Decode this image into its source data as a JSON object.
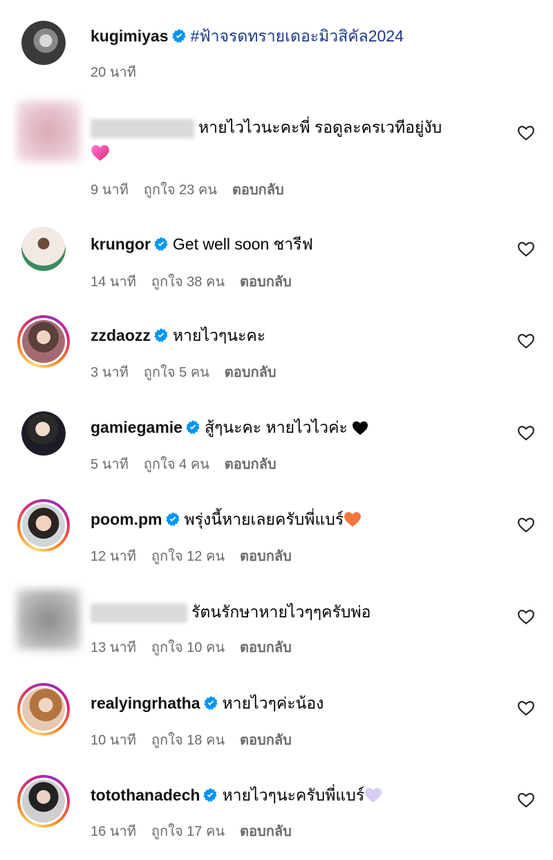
{
  "caption": {
    "username": "kugimiyas",
    "hashtag": "#ฟ้าจรดทรายเดอะมิวสิคัล2024",
    "time": "20 นาที"
  },
  "comments": [
    {
      "username": "",
      "text": "หายไวไวนะคะพี่ รอดูละครเวทีอยู่งับ",
      "time": "9 นาที",
      "likes": "ถูกใจ 23 คน",
      "reply": "ตอบกลับ",
      "emoji": "pink-heart"
    },
    {
      "username": "krungor",
      "text": "Get well soon ชารีฟ",
      "time": "14 นาที",
      "likes": "ถูกใจ 38 คน",
      "reply": "ตอบกลับ"
    },
    {
      "username": "zzdaozz",
      "text": "หายไวๆนะคะ",
      "time": "3 นาที",
      "likes": "ถูกใจ 5 คน",
      "reply": "ตอบกลับ"
    },
    {
      "username": "gamiegamie",
      "text": "สู้ๆนะคะ หายไวไวค่ะ",
      "time": "5 นาที",
      "likes": "ถูกใจ 4 คน",
      "reply": "ตอบกลับ",
      "emoji": "black-heart"
    },
    {
      "username": "poom.pm",
      "text": "พรุ่งนี้หายเลยครับพี่แบร์",
      "time": "12 นาที",
      "likes": "ถูกใจ 12 คน",
      "reply": "ตอบกลับ",
      "emoji": "orange-heart"
    },
    {
      "username": "",
      "text": "รัตนรักษาหายไวๆๆครับพ่อ",
      "time": "13 นาที",
      "likes": "ถูกใจ 10 คน",
      "reply": "ตอบกลับ"
    },
    {
      "username": "realyingrhatha",
      "text": "หายไวๆค่ะน้อง",
      "time": "10 นาที",
      "likes": "ถูกใจ 18 คน",
      "reply": "ตอบกลับ"
    },
    {
      "username": "totothanadech",
      "text": "หายไวๆนะครับพี่แบร์",
      "time": "16 นาที",
      "likes": "ถูกใจ 17 คน",
      "reply": "ตอบกลับ",
      "emoji": "lavender-heart"
    }
  ],
  "icons": {
    "verified": "verified-badge-icon",
    "like": "heart-outline-icon"
  },
  "colors": {
    "verified": "#0095f6",
    "meta": "#6b6b6b",
    "hashtag": "#1b3a8a"
  }
}
